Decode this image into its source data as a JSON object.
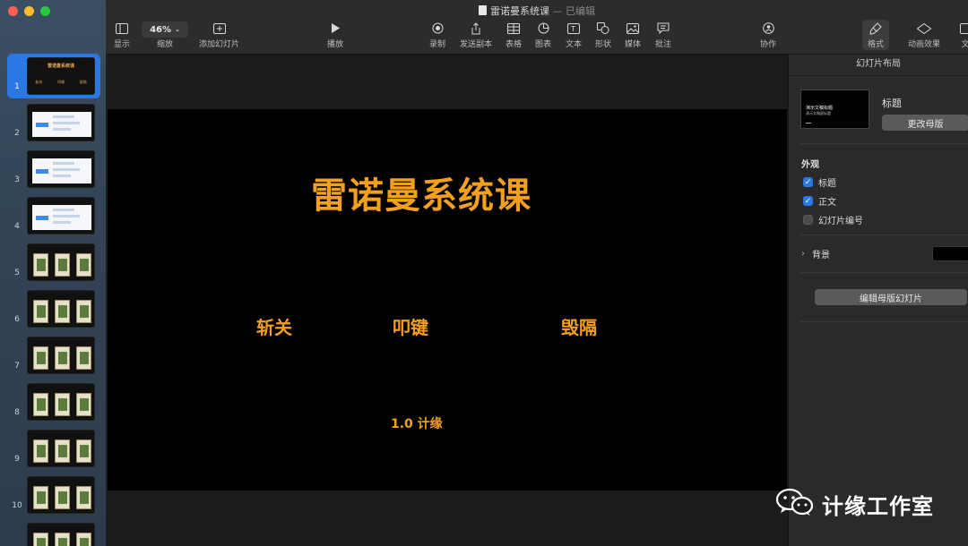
{
  "window": {
    "doc_title": "雷诺曼系统课",
    "separator": "—",
    "status": "已编辑"
  },
  "toolbar": {
    "view_label": "显示",
    "zoom_value": "46%",
    "zoom_label": "缩放",
    "add_slide_label": "添加幻灯片",
    "play_label": "播放",
    "record_label": "录制",
    "send_copy_label": "发送副本",
    "table_label": "表格",
    "chart_label": "图表",
    "text_label": "文本",
    "shape_label": "形状",
    "media_label": "媒体",
    "comment_label": "批注",
    "collaborate_label": "协作",
    "format_label": "格式",
    "animate_label": "动画效果",
    "document_label": "文"
  },
  "navigator": {
    "slides": [
      {
        "num": "1",
        "kind": "title"
      },
      {
        "num": "2",
        "kind": "white"
      },
      {
        "num": "3",
        "kind": "white"
      },
      {
        "num": "4",
        "kind": "white"
      },
      {
        "num": "5",
        "kind": "cards"
      },
      {
        "num": "6",
        "kind": "cards"
      },
      {
        "num": "7",
        "kind": "cards"
      },
      {
        "num": "8",
        "kind": "cards"
      },
      {
        "num": "9",
        "kind": "cards"
      },
      {
        "num": "10",
        "kind": "cards"
      },
      {
        "num": "11",
        "kind": "cards"
      }
    ]
  },
  "slide": {
    "title": "雷诺曼系统课",
    "items": [
      "斩关",
      "叩键",
      "毁隔"
    ],
    "subtitle": "1.0 计缘"
  },
  "inspector": {
    "header": "幻灯片布局",
    "layout_thumb_title": "演示文稿标题",
    "layout_thumb_sub": "演示文稿副标题",
    "layout_name": "标题",
    "change_master_label": "更改母版",
    "appearance_label": "外观",
    "checkboxes": [
      {
        "label": "标题",
        "checked": true
      },
      {
        "label": "正文",
        "checked": true
      },
      {
        "label": "幻灯片编号",
        "checked": false
      }
    ],
    "background_label": "背景",
    "edit_master_label": "编辑母版幻灯片"
  },
  "watermark": {
    "text": "计缘工作室"
  },
  "colors": {
    "accent": "#2b78e4",
    "slide_text": "#f3a01f",
    "slide_bg": "#000000"
  }
}
